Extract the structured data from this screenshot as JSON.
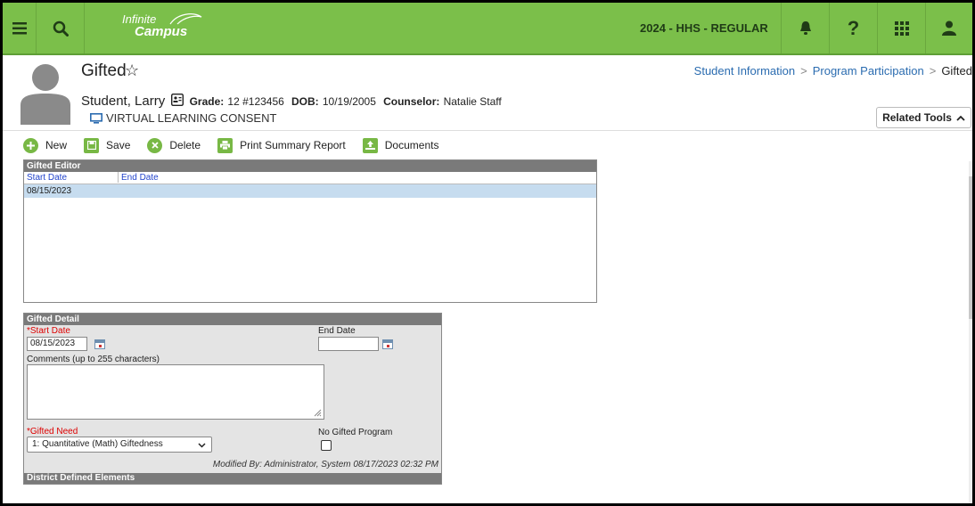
{
  "topbar": {
    "logo_line1": "Infinite",
    "logo_line2": "Campus",
    "calendar": "2024 - HHS - REGULAR",
    "icons": [
      "menu-icon",
      "search-icon",
      "bell-icon",
      "help-icon",
      "app-grid-icon",
      "user-icon"
    ],
    "color": "#7bbf4a"
  },
  "header": {
    "title": "Gifted",
    "breadcrumb": [
      "Student Information",
      "Program Participation",
      "Gifted"
    ],
    "student_name": "Student, Larry",
    "grade_label": "Grade:",
    "grade_value": "12 #123456",
    "dob_label": "DOB:",
    "dob_value": "10/19/2005",
    "counselor_label": "Counselor:",
    "counselor_value": "Natalie Staff",
    "consent": "VIRTUAL LEARNING CONSENT",
    "related_tools": "Related Tools"
  },
  "toolbar": {
    "new": "New",
    "save": "Save",
    "delete": "Delete",
    "print": "Print Summary Report",
    "documents": "Documents"
  },
  "editor": {
    "title": "Gifted Editor",
    "columns": [
      "Start Date",
      "End Date"
    ],
    "rows": [
      {
        "start": "08/15/2023",
        "end": ""
      }
    ]
  },
  "detail": {
    "title": "Gifted Detail",
    "start_label": "*Start Date",
    "start_value": "08/15/2023",
    "end_label": "End Date",
    "end_value": "",
    "comments_label": "Comments (up to 255 characters)",
    "comments_value": "",
    "need_label": "*Gifted Need",
    "need_value": "1: Quantitative (Math) Giftedness",
    "no_program_label": "No Gifted Program",
    "no_program_checked": false,
    "modified": "Modified By: Administrator, System 08/17/2023 02:32 PM",
    "district_elements": "District Defined Elements"
  }
}
